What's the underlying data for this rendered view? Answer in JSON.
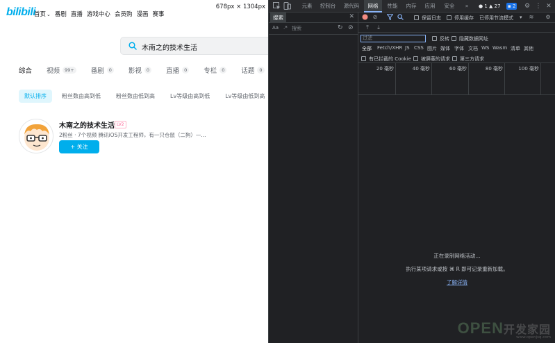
{
  "browser_overlay": {
    "size_tip": "678px × 1304px"
  },
  "bilibili": {
    "logo": "bilibili",
    "nav": [
      {
        "label": "首页",
        "has_dropdown": true
      },
      {
        "label": "番剧"
      },
      {
        "label": "直播"
      },
      {
        "label": "游戏中心"
      },
      {
        "label": "会员购"
      },
      {
        "label": "漫画"
      },
      {
        "label": "赛事"
      }
    ],
    "search": {
      "value": "木南之的技术生活",
      "icon": "search-icon"
    },
    "tabs": [
      {
        "label": "综合",
        "count": ""
      },
      {
        "label": "视频",
        "count": "99+"
      },
      {
        "label": "番剧",
        "count": "0"
      },
      {
        "label": "影视",
        "count": "0"
      },
      {
        "label": "直播",
        "count": "0"
      },
      {
        "label": "专栏",
        "count": "0"
      },
      {
        "label": "话题",
        "count": "0"
      }
    ],
    "sorts": [
      "默认排序",
      "粉丝数由高到低",
      "粉丝数由低到高",
      "Lv等级由高到低",
      "Lv等级由低到高"
    ],
    "result": {
      "name": "木南之的技术生活",
      "level_badge": "LV2",
      "desc": "2粉丝 · 7个视频  腾讯iOS开发工程师，有一只仓鼠（二狗）—...",
      "follow_label": "+ 关注"
    },
    "accent_color": "#00aeec"
  },
  "devtools": {
    "tabs": [
      "元素",
      "控制台",
      "源代码",
      "网络",
      "性能",
      "内存",
      "应用",
      "安全",
      "»"
    ],
    "active_tab": "网络",
    "badges": {
      "errors": "1",
      "warnings": "27",
      "info": "2"
    },
    "search_panel": {
      "title": "搜索",
      "match_case": "Aa",
      "regex": ".*",
      "placeholder": "搜索"
    },
    "network": {
      "preserve_log": "保留日志",
      "disable_cache": "停用缓存",
      "throttle": "已停用节流模式",
      "filter_placeholder": "过滤",
      "invert": "反转",
      "hide_data_urls": "隐藏数据网址",
      "types": [
        "全部",
        "Fetch/XHR",
        "JS",
        "CSS",
        "图片",
        "媒体",
        "字体",
        "文档",
        "WS",
        "Wasm",
        "清单",
        "其他"
      ],
      "active_type": "全部",
      "blocked_cookies": "有已拦截的 Cookie",
      "blocked_requests": "被屏蔽的请求",
      "third_party": "第三方请求",
      "timeline_ticks": [
        "20 毫秒",
        "40 毫秒",
        "60 毫秒",
        "80 毫秒",
        "100 毫秒"
      ],
      "empty_line1": "正在录制网络活动…",
      "empty_line2": "执行某项请求或按 ⌘ R 即可记录重新加载。",
      "learn_more": "了解详情"
    }
  },
  "watermark": {
    "main_latin": "OPEN",
    "main_cn": "开发家园",
    "sub": "www.openjsq.com"
  }
}
